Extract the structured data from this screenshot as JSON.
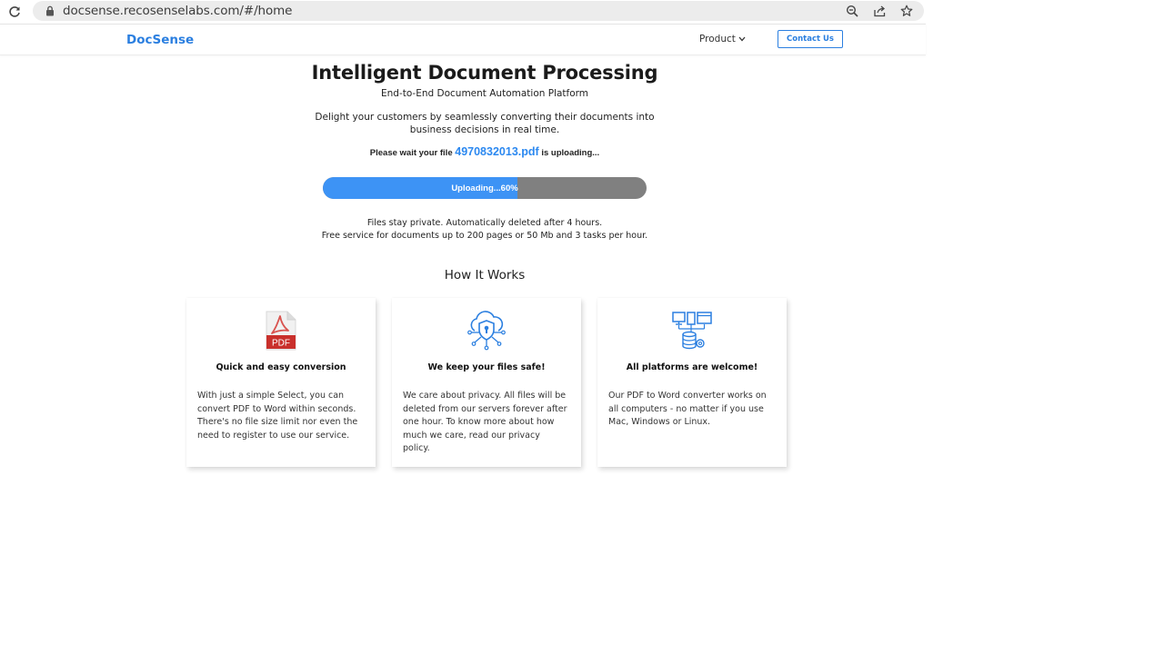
{
  "browser": {
    "url": "docsense.recosenselabs.com/#/home",
    "icons": [
      "reload-icon",
      "lock-icon",
      "zoom-out-icon",
      "share-icon",
      "star-icon"
    ]
  },
  "header": {
    "brand": "DocSense",
    "nav_product": "Product",
    "contact": "Contact Us",
    "brand_color": "#2b7fe0"
  },
  "hero": {
    "title": "Intelligent Document Processing",
    "subtitle": "End-to-End Document Automation Platform",
    "description_line1": "Delight your customers by seamlessly converting their documents into",
    "description_line2": "business decisions in real time.",
    "upload_prefix": "Please wait your file",
    "file_name": "4970832013.pdf",
    "upload_suffix": "is uploading..."
  },
  "progress": {
    "label": "Uploading...60%",
    "percent": 60,
    "fill_color": "#3d93f5",
    "track_color": "#808080"
  },
  "notes": {
    "line1": "Files stay private. Automatically deleted after 4 hours.",
    "line2": "Free service for documents up to 200 pages or 50 Mb and 3 tasks per hour."
  },
  "how_it_works": {
    "title": "How It Works",
    "cards": [
      {
        "icon": "pdf-icon",
        "icon_label": "PDF",
        "title": "Quick and easy conversion",
        "text": "With just a simple Select, you can convert PDF to Word within seconds. There's no file size limit nor even the need to register to use our service."
      },
      {
        "icon": "cloud-security-icon",
        "title": "We keep your files safe!",
        "text": "We care about privacy. All files will be deleted from our servers forever after one hour. To know more about how much we care, read our privacy policy."
      },
      {
        "icon": "platforms-icon",
        "title": "All platforms are welcome!",
        "text": "Our PDF to Word converter works on all computers - no matter if you use Mac, Windows or Linux."
      }
    ]
  }
}
